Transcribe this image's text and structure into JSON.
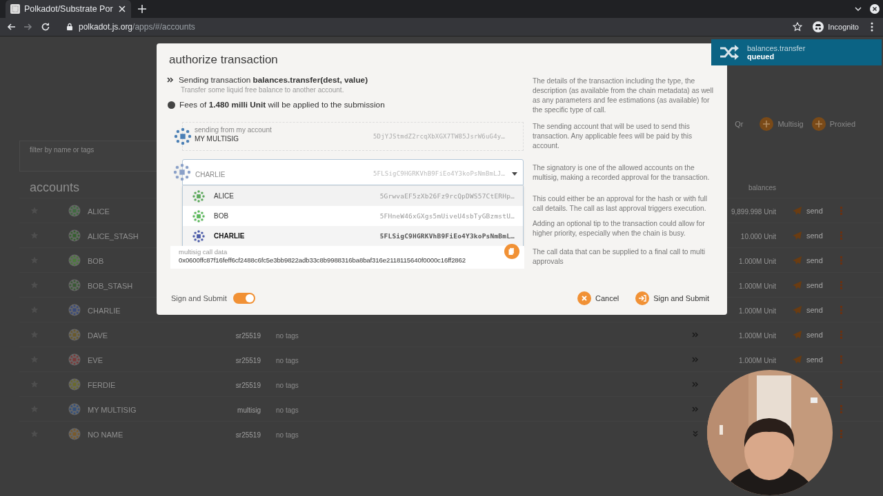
{
  "browser": {
    "tab_title": "Polkadot/Substrate Por",
    "url_host": "polkadot.js.org",
    "url_path": "/apps/#/accounts",
    "profile": "Incognito"
  },
  "page": {
    "header_buttons": [
      {
        "label": "Qr",
        "kind": "text"
      },
      {
        "label": "Multisig",
        "kind": "add"
      },
      {
        "label": "Proxied",
        "kind": "add"
      }
    ],
    "filter": {
      "placeholder": "filter by name or tags"
    },
    "heading": "accounts",
    "balance_header": "balances",
    "accounts": [
      {
        "name": "ALICE",
        "kind": "plain",
        "color": "#3f6b3f",
        "balance": "9,899.998 Unit",
        "send": "send"
      },
      {
        "name": "ALICE_STASH",
        "kind": "plain",
        "color": "#35602f",
        "balance": "10.000 Unit",
        "send": "send"
      },
      {
        "name": "BOB",
        "kind": "plain",
        "color": "#4a7a3a",
        "balance": "1.000M Unit",
        "send": "send"
      },
      {
        "name": "BOB_STASH",
        "kind": "plain",
        "color": "#3a5a35",
        "balance": "1.000M Unit",
        "send": "send"
      },
      {
        "name": "CHARLIE",
        "kind": "plain",
        "color": "#3a4a7a",
        "balance": "1.000M Unit",
        "send": "send"
      },
      {
        "name": "DAVE",
        "kind": "more",
        "color": "#6a5a2a",
        "type": "sr25519",
        "tags": "no tags",
        "balance": "1.000M Unit",
        "send": "send"
      },
      {
        "name": "EVE",
        "kind": "more",
        "color": "#7a3a3a",
        "type": "sr25519",
        "tags": "no tags",
        "balance": "1.000M Unit",
        "send": "send"
      },
      {
        "name": "FERDIE",
        "kind": "more",
        "color": "#6a6a2a",
        "type": "sr25519",
        "tags": "no tags"
      },
      {
        "name": "MY MULTISIG",
        "kind": "more",
        "color": "#34507a",
        "type": "multisig",
        "tags": "no tags"
      },
      {
        "name": "NO NAME",
        "kind": "expand",
        "color": "#7a5a2a",
        "type": "sr25519",
        "tags": "no tags"
      }
    ]
  },
  "modal": {
    "title": "authorize transaction",
    "transaction": "Sending transaction **balances.transfer(dest, value)**",
    "description": "Transfer some liquid free balance to another account.",
    "fees": "Fees of **1.480 milli Unit** will be applied to the submission",
    "sender": {
      "label": "sending from my account",
      "name": "MY MULTISIG",
      "address": "5DjYJStmdZ2rcqXbXGX7TW85JsrW6uG4y…",
      "color": "#4a7fb5"
    },
    "signatory": {
      "name": "CHARLIE",
      "address": "5FLSigC9HGRKVhB9FiEo4Y3koPsNmBmLJ…",
      "color": "#8aa0c8",
      "expanded": true,
      "options": [
        {
          "name": "ALICE",
          "address": "5GrwvaEF5zXb26Fz9rcQpDWS57CtERHp…",
          "color": "#5aa85a",
          "selected": false
        },
        {
          "name": "BOB",
          "address": "5FHneW46xGXgs5mUiveU4sbTyGBzmstU…",
          "color": "#5ab85a",
          "selected": false
        },
        {
          "name": "CHARLIE",
          "address": "5FLSigC9HGRKVhB9FiEo4Y3koPsNmBmL…",
          "color": "#4a5aa8",
          "selected": true
        }
      ]
    },
    "call_data": {
      "label": "multisig call data",
      "value": "0x0600ffc87f16feff6cf2488c6fc5e3bb9822adb33c8b9988316ba8baf316e2118115640f0000c16ff2862"
    },
    "toggle": {
      "label": "Sign and Submit",
      "on": true
    },
    "buttons": [
      {
        "label": "Cancel",
        "kind": "cancel"
      },
      {
        "label": "Sign and Submit",
        "kind": "submit"
      }
    ],
    "help": [
      "The details of the transaction including the type, the description (as available from the chain metadata) as well as any parameters and fee estimations (as available) for the specific type of call.",
      "The sending account that will be used to send this transaction. Any applicable fees will be paid by this account.",
      "The signatory is one of the allowed accounts on the multisig, making a recorded approval for the transaction.",
      "This could either be an approval for the hash or with full call details. The call as last approval triggers execution.",
      "Adding an optional tip to the transaction could allow for higher priority, especially when the chain is busy.",
      "The call data that can be supplied to a final call to multi approvals"
    ]
  },
  "notification": {
    "title": "balances.transfer",
    "status": "queued"
  }
}
